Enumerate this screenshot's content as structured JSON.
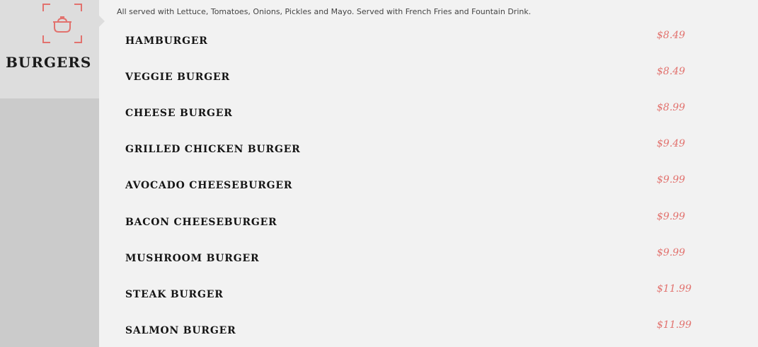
{
  "colors": {
    "accent": "#e2726e",
    "sidebar_bg": "#cbcbcb",
    "tab_bg": "#dddddd",
    "content_bg": "#f2f2f2"
  },
  "category": {
    "icon": "cooking-pot-icon",
    "title": "BURGERS",
    "description": "All served with Lettuce, Tomatoes, Onions, Pickles and Mayo. Served with French Fries and Fountain Drink."
  },
  "menu": {
    "items": [
      {
        "name": "HAMBURGER",
        "price": "$8.49"
      },
      {
        "name": "VEGGIE BURGER",
        "price": "$8.49"
      },
      {
        "name": "CHEESE BURGER",
        "price": "$8.99"
      },
      {
        "name": "GRILLED CHICKEN BURGER",
        "price": "$9.49"
      },
      {
        "name": "AVOCADO CHEESEBURGER",
        "price": "$9.99"
      },
      {
        "name": "BACON CHEESEBURGER",
        "price": "$9.99"
      },
      {
        "name": "MUSHROOM BURGER",
        "price": "$9.99"
      },
      {
        "name": "STEAK BURGER",
        "price": "$11.99"
      },
      {
        "name": "SALMON BURGER",
        "price": "$11.99"
      }
    ]
  }
}
